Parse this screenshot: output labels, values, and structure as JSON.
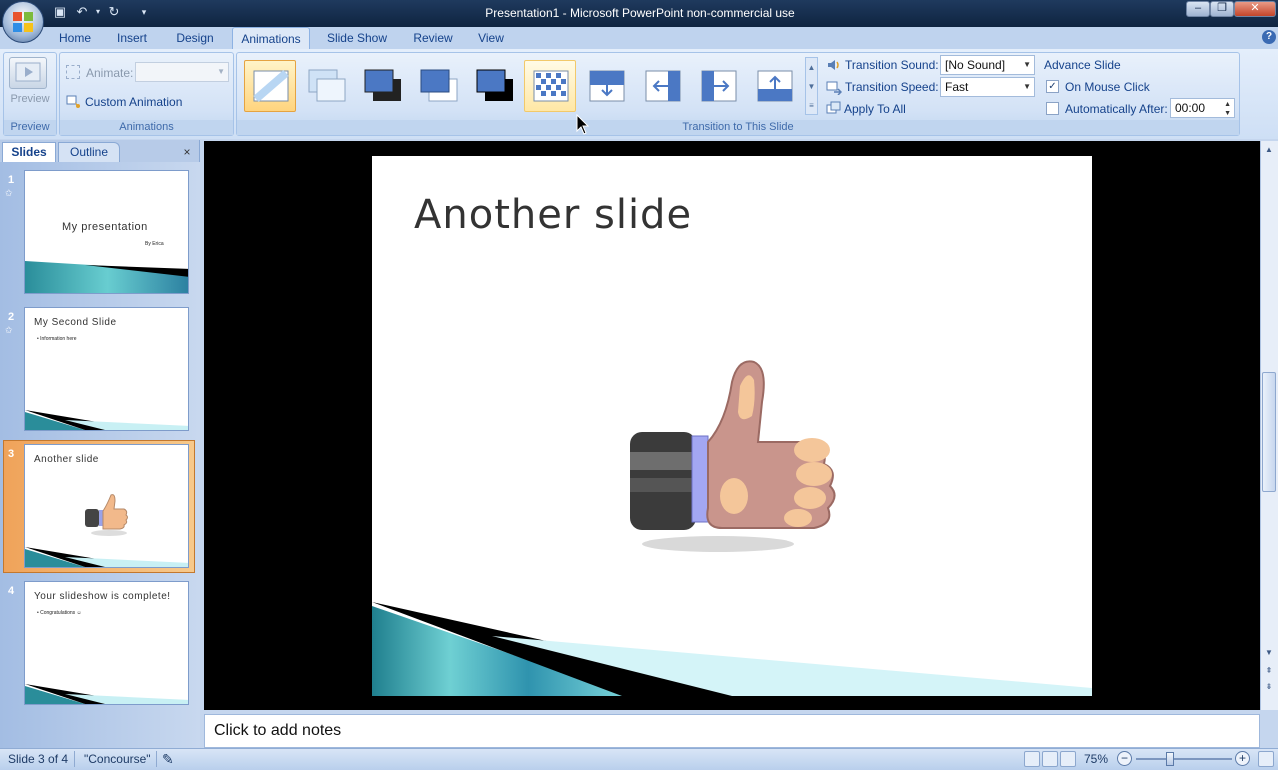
{
  "window": {
    "title": "Presentation1 - Microsoft PowerPoint non-commercial use"
  },
  "tabs": [
    "Home",
    "Insert",
    "Design",
    "Animations",
    "Slide Show",
    "Review",
    "View"
  ],
  "active_tab": "Animations",
  "ribbon": {
    "preview": {
      "button_label": "Preview",
      "group_label": "Preview"
    },
    "animations": {
      "animate_label": "Animate:",
      "animate_value": "",
      "custom_animation_label": "Custom Animation",
      "group_label": "Animations"
    },
    "transition": {
      "group_label": "Transition to This Slide",
      "sound_label": "Transition Sound:",
      "sound_value": "[No Sound]",
      "speed_label": "Transition Speed:",
      "speed_value": "Fast",
      "apply_all_label": "Apply To All"
    },
    "advance": {
      "title": "Advance Slide",
      "mouse_click_label": "On Mouse Click",
      "mouse_click_checked": true,
      "auto_after_label": "Automatically After:",
      "auto_after_checked": false,
      "auto_after_value": "00:00"
    }
  },
  "pane": {
    "tab_slides": "Slides",
    "tab_outline": "Outline",
    "close_glyph": "×"
  },
  "thumbnails": [
    {
      "num": "1",
      "title": "My presentation",
      "subtitle": "By Erica"
    },
    {
      "num": "2",
      "title": "My Second Slide",
      "bullet": "• Information here"
    },
    {
      "num": "3",
      "title": "Another slide"
    },
    {
      "num": "4",
      "title": "Your slideshow is complete!",
      "bullet": "• Congratulations ☺"
    }
  ],
  "selected_slide": 3,
  "slide": {
    "title": "Another slide"
  },
  "notes": {
    "placeholder": "Click to add notes"
  },
  "status": {
    "slide_counter": "Slide 3 of 4",
    "theme": "\"Concourse\"",
    "zoom": "75%",
    "zoom_percent": 75
  },
  "colors": {
    "accent": "#15428b",
    "ribbon": "#dde8f7",
    "selection": "#ffd47e"
  }
}
